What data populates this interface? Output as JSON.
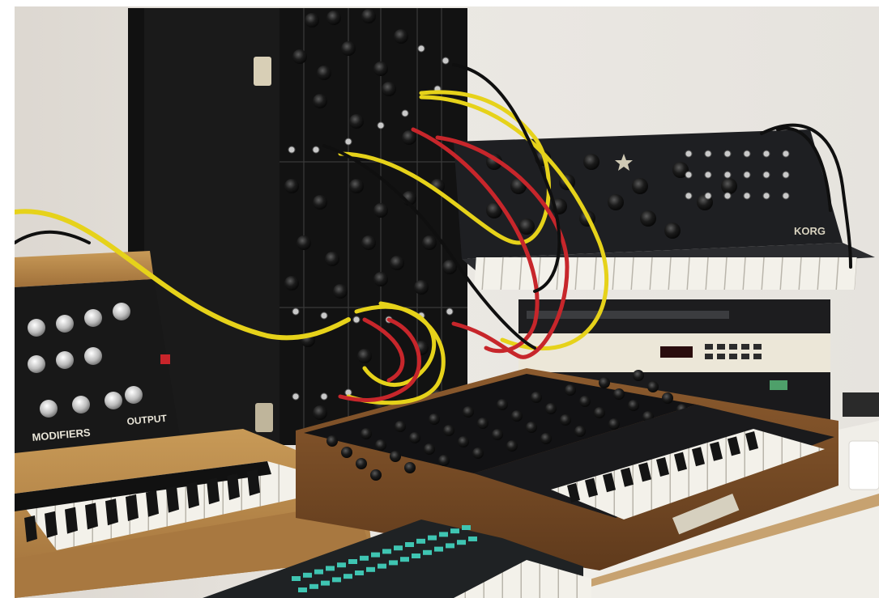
{
  "scene": {
    "description_free": true,
    "colors": {
      "wall": "#e9e6e1",
      "wall_shadow": "#d8d4ce",
      "cabinet": "#1c1c1c",
      "panel": "#141414",
      "wood": "#b98a4a",
      "wood_dark": "#8a5a2c",
      "desk": "#f1efe9",
      "cable_yellow": "#e9d21a",
      "cable_red": "#c7262b",
      "cable_black": "#0e0e0e",
      "key_white": "#f3f1ea",
      "key_black": "#151515",
      "teal_buttons": "#3fc5b2",
      "rack_cream": "#ece7d8",
      "rack_dark": "#1d1d1f"
    }
  },
  "labels": {
    "modifiers": "MODIFIERS",
    "output": "OUTPUT",
    "brand_synth": "KORG"
  },
  "icons": {
    "knob": "knob-icon",
    "jack": "patch-jack-icon",
    "star": "star-icon"
  }
}
